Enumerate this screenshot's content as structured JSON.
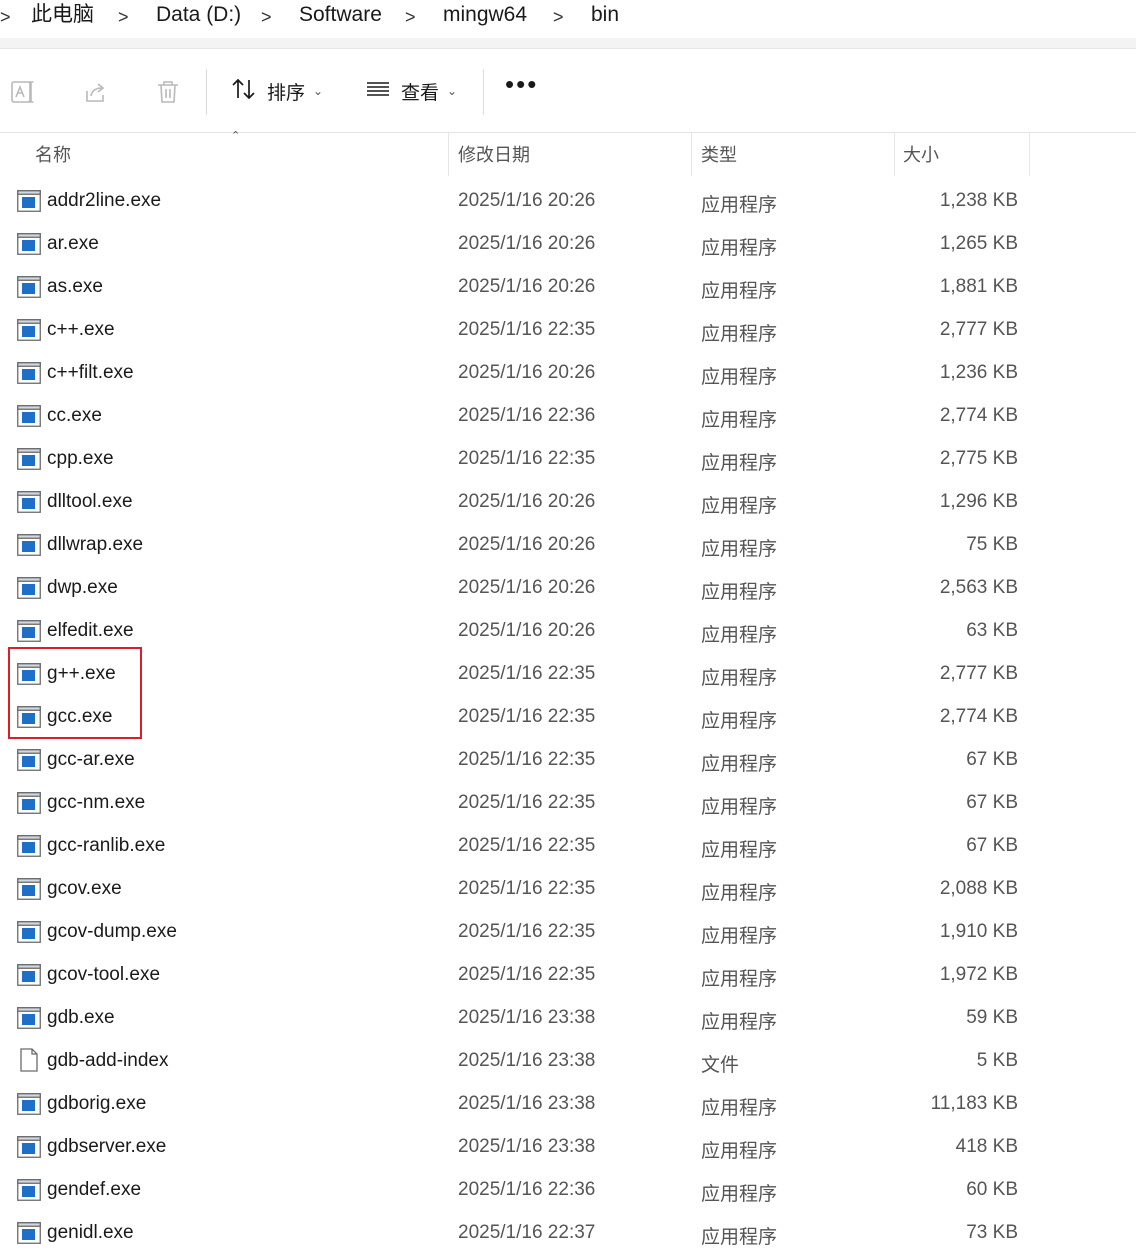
{
  "breadcrumb": {
    "items": [
      "此电脑",
      "Data (D:)",
      "Software",
      "mingw64",
      "bin"
    ],
    "separator": ">"
  },
  "toolbar": {
    "sort_label": "排序",
    "view_label": "查看",
    "more_label": "•••"
  },
  "columns": {
    "name": "名称",
    "modified": "修改日期",
    "type": "类型",
    "size": "大小"
  },
  "files": [
    {
      "name": "addr2line.exe",
      "modified": "2025/1/16 20:26",
      "type": "应用程序",
      "size": "1,238 KB",
      "icon": "exe-icon"
    },
    {
      "name": "ar.exe",
      "modified": "2025/1/16 20:26",
      "type": "应用程序",
      "size": "1,265 KB",
      "icon": "exe-icon"
    },
    {
      "name": "as.exe",
      "modified": "2025/1/16 20:26",
      "type": "应用程序",
      "size": "1,881 KB",
      "icon": "exe-icon"
    },
    {
      "name": "c++.exe",
      "modified": "2025/1/16 22:35",
      "type": "应用程序",
      "size": "2,777 KB",
      "icon": "exe-icon"
    },
    {
      "name": "c++filt.exe",
      "modified": "2025/1/16 20:26",
      "type": "应用程序",
      "size": "1,236 KB",
      "icon": "exe-icon"
    },
    {
      "name": "cc.exe",
      "modified": "2025/1/16 22:36",
      "type": "应用程序",
      "size": "2,774 KB",
      "icon": "exe-icon"
    },
    {
      "name": "cpp.exe",
      "modified": "2025/1/16 22:35",
      "type": "应用程序",
      "size": "2,775 KB",
      "icon": "exe-icon"
    },
    {
      "name": "dlltool.exe",
      "modified": "2025/1/16 20:26",
      "type": "应用程序",
      "size": "1,296 KB",
      "icon": "exe-icon"
    },
    {
      "name": "dllwrap.exe",
      "modified": "2025/1/16 20:26",
      "type": "应用程序",
      "size": "75 KB",
      "icon": "exe-icon"
    },
    {
      "name": "dwp.exe",
      "modified": "2025/1/16 20:26",
      "type": "应用程序",
      "size": "2,563 KB",
      "icon": "exe-icon"
    },
    {
      "name": "elfedit.exe",
      "modified": "2025/1/16 20:26",
      "type": "应用程序",
      "size": "63 KB",
      "icon": "exe-icon"
    },
    {
      "name": "g++.exe",
      "modified": "2025/1/16 22:35",
      "type": "应用程序",
      "size": "2,777 KB",
      "icon": "exe-icon"
    },
    {
      "name": "gcc.exe",
      "modified": "2025/1/16 22:35",
      "type": "应用程序",
      "size": "2,774 KB",
      "icon": "exe-icon"
    },
    {
      "name": "gcc-ar.exe",
      "modified": "2025/1/16 22:35",
      "type": "应用程序",
      "size": "67 KB",
      "icon": "exe-icon"
    },
    {
      "name": "gcc-nm.exe",
      "modified": "2025/1/16 22:35",
      "type": "应用程序",
      "size": "67 KB",
      "icon": "exe-icon"
    },
    {
      "name": "gcc-ranlib.exe",
      "modified": "2025/1/16 22:35",
      "type": "应用程序",
      "size": "67 KB",
      "icon": "exe-icon"
    },
    {
      "name": "gcov.exe",
      "modified": "2025/1/16 22:35",
      "type": "应用程序",
      "size": "2,088 KB",
      "icon": "exe-icon"
    },
    {
      "name": "gcov-dump.exe",
      "modified": "2025/1/16 22:35",
      "type": "应用程序",
      "size": "1,910 KB",
      "icon": "exe-icon"
    },
    {
      "name": "gcov-tool.exe",
      "modified": "2025/1/16 22:35",
      "type": "应用程序",
      "size": "1,972 KB",
      "icon": "exe-icon"
    },
    {
      "name": "gdb.exe",
      "modified": "2025/1/16 23:38",
      "type": "应用程序",
      "size": "59 KB",
      "icon": "exe-icon"
    },
    {
      "name": "gdb-add-index",
      "modified": "2025/1/16 23:38",
      "type": "文件",
      "size": "5 KB",
      "icon": "file-icon"
    },
    {
      "name": "gdborig.exe",
      "modified": "2025/1/16 23:38",
      "type": "应用程序",
      "size": "11,183 KB",
      "icon": "exe-icon"
    },
    {
      "name": "gdbserver.exe",
      "modified": "2025/1/16 23:38",
      "type": "应用程序",
      "size": "418 KB",
      "icon": "exe-icon"
    },
    {
      "name": "gendef.exe",
      "modified": "2025/1/16 22:36",
      "type": "应用程序",
      "size": "60 KB",
      "icon": "exe-icon"
    },
    {
      "name": "genidl.exe",
      "modified": "2025/1/16 22:37",
      "type": "应用程序",
      "size": "73 KB",
      "icon": "exe-icon"
    }
  ],
  "colors": {
    "highlight_box": "#d9202a",
    "exe_icon_blue": "#1e6fc8"
  }
}
